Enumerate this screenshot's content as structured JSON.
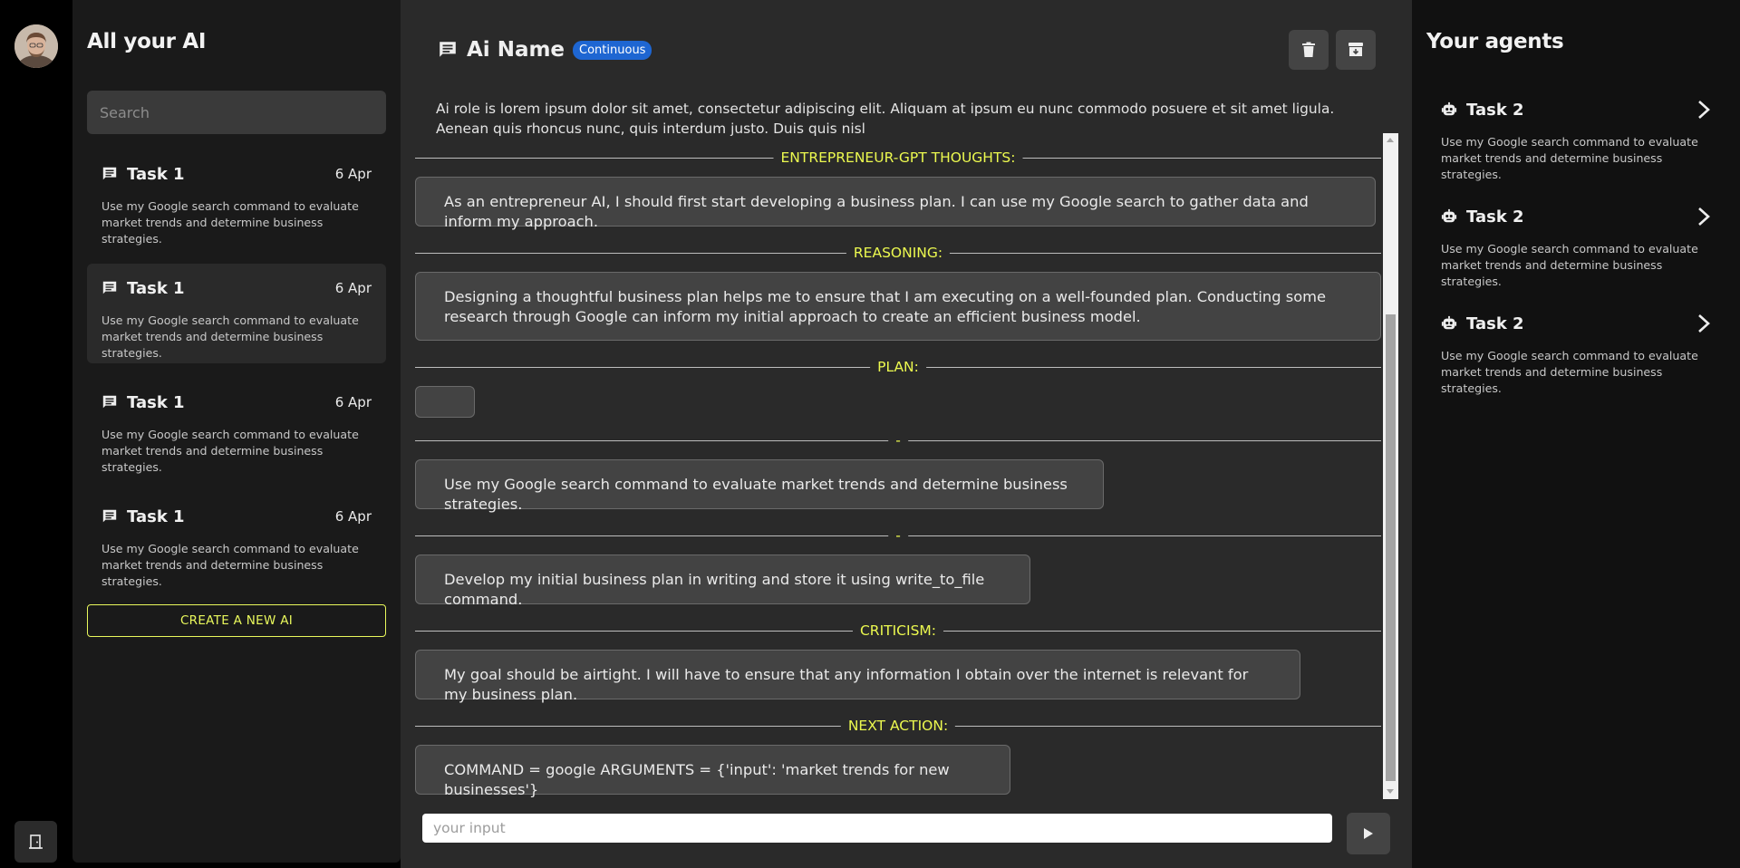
{
  "sidebar": {
    "title": "All your AI",
    "search_placeholder": "Search",
    "tasks": [
      {
        "name": "Task 1",
        "date": "6 Apr",
        "desc": "Use my Google search command to evaluate market trends and determine business strategies.",
        "icon": "chat-icon"
      },
      {
        "name": "Task 1",
        "date": "6 Apr",
        "desc": "Use my Google search command to evaluate market trends and determine business strategies.",
        "icon": "chat-icon"
      },
      {
        "name": "Task 1",
        "date": "6 Apr",
        "desc": "Use my Google search command to evaluate market trends and determine business strategies.",
        "icon": "chat-icon"
      },
      {
        "name": "Task 1",
        "date": "6 Apr",
        "desc": "Use my Google search command to evaluate market trends and determine business strategies.",
        "icon": "chat-icon"
      }
    ],
    "create_label": "CREATE A NEW AI"
  },
  "main": {
    "ai_name": "Ai Name",
    "badge": "Continuous",
    "role": "Ai role is lorem ipsum dolor sit amet, consectetur adipiscing elit. Aliquam at ipsum eu nunc commodo posuere et sit amet ligula. Aenean quis rhoncus nunc, quis interdum justo. Duis quis nisl",
    "sections": {
      "thoughts": {
        "label": "ENTREPRENEUR-GPT THOUGHTS:",
        "text": "As an entrepreneur AI, I should first start developing a business plan. I can use my Google search to gather data and inform my approach."
      },
      "reasoning": {
        "label": "REASONING:",
        "text": "Designing a thoughtful business plan helps me to ensure that I am executing on a well-founded plan. Conducting some research through Google can inform my initial approach to create an efficient business model."
      },
      "plan": {
        "label": "PLAN:",
        "text": ""
      },
      "plan_item_1": {
        "label": "-",
        "text": "Use my Google search command to evaluate market trends and determine business strategies."
      },
      "plan_item_2": {
        "label": "-",
        "text": "Develop my initial business plan in writing and store it using write_to_file command."
      },
      "criticism": {
        "label": "CRITICISM:",
        "text": "My goal should be airtight. I will have to ensure that any information I obtain over the internet is relevant for my business plan."
      },
      "next_action": {
        "label": "NEXT ACTION:",
        "text": "COMMAND = google ARGUMENTS = {'input': 'market trends for new businesses'}"
      }
    },
    "input_placeholder": "your input"
  },
  "right": {
    "title": "Your agents",
    "agents": [
      {
        "name": "Task 2",
        "desc": "Use my Google search command to evaluate market trends and determine business strategies.",
        "icon": "robot-icon"
      },
      {
        "name": "Task 2",
        "desc": "Use my Google search command to evaluate market trends and determine business strategies.",
        "icon": "robot-icon"
      },
      {
        "name": "Task 2",
        "desc": "Use my Google search command to evaluate market trends and determine business strategies.",
        "icon": "robot-icon"
      }
    ]
  },
  "colors": {
    "accent": "#ecf94f",
    "badge": "#1e66d2",
    "panel": "#1a1a1a",
    "main_bg": "#2a2a2a",
    "message_bg": "#434343"
  }
}
